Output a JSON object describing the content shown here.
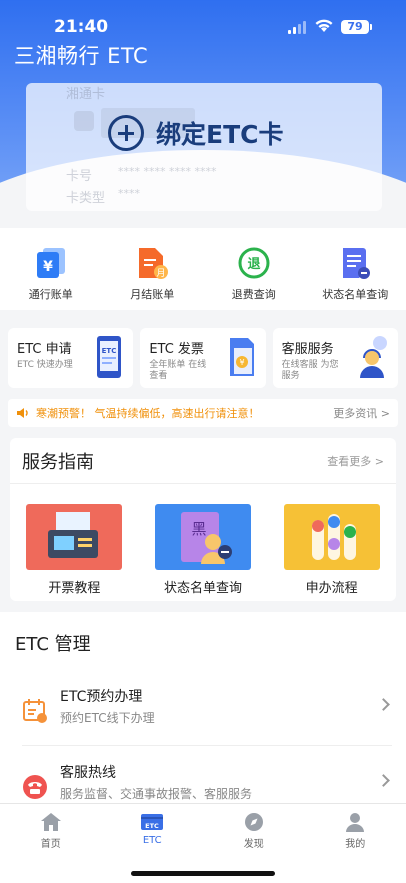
{
  "status_bar": {
    "time": "21:40",
    "battery": "79"
  },
  "header": {
    "app_title": "三湘畅行 ETC"
  },
  "card": {
    "bind_label": "绑定ETC卡",
    "faint_bank": "湘通卡",
    "faint_card_no_label": "卡号",
    "faint_card_no": "**** **** **** ****",
    "faint_type_label": "卡类型",
    "faint_type": "****"
  },
  "quick_actions": [
    {
      "label": "通行账单",
      "icon": "yuan-bill-icon",
      "color": "#2e7cf6"
    },
    {
      "label": "月结账单",
      "icon": "monthly-bill-icon",
      "color": "#f56a2a"
    },
    {
      "label": "退费查询",
      "icon": "refund-icon",
      "color": "#2bb24c"
    },
    {
      "label": "状态名单查询",
      "icon": "status-list-icon",
      "color": "#5a6ff0"
    }
  ],
  "services": [
    {
      "title": "ETC 申请",
      "sub": "ETC 快速办理"
    },
    {
      "title": "ETC 发票",
      "sub": "全年账单 在线查看"
    },
    {
      "title": "客服服务",
      "sub": "在线客服 为您服务"
    }
  ],
  "notice": {
    "text": "寒潮预警！ 气温持续偏低，高速出行请注意！",
    "more": "更多资讯 >"
  },
  "guide": {
    "title": "服务指南",
    "more": "查看更多 >",
    "items": [
      {
        "label": "开票教程"
      },
      {
        "label": "状态名单查询"
      },
      {
        "label": "申办流程"
      }
    ]
  },
  "management": {
    "title": "ETC 管理",
    "rows": [
      {
        "title": "ETC预约办理",
        "sub": "预约ETC线下办理"
      },
      {
        "title": "客服热线",
        "sub": "服务监督、交通事故报警、客服服务"
      }
    ]
  },
  "tabbar": {
    "active": "ETC",
    "tabs": [
      {
        "label": "首页"
      },
      {
        "label": "ETC"
      },
      {
        "label": "发现"
      },
      {
        "label": "我的"
      }
    ]
  },
  "colors": {
    "primary": "#2f6ff0",
    "navy": "#1a3d7c",
    "notice": "#f0900a"
  }
}
